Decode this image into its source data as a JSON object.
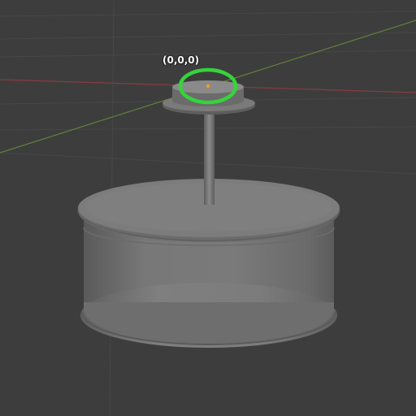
{
  "viewport": {
    "background_color": "#3d3d3d",
    "grid_color": "#474747",
    "x_axis_color": "#8a3b44",
    "y_axis_color": "#65803a",
    "object_color": "#7a7a7a",
    "origin_point_color": "#ff9a1e",
    "highlight_ring_color": "#34d43a",
    "origin_label": "(0,0,0)"
  }
}
